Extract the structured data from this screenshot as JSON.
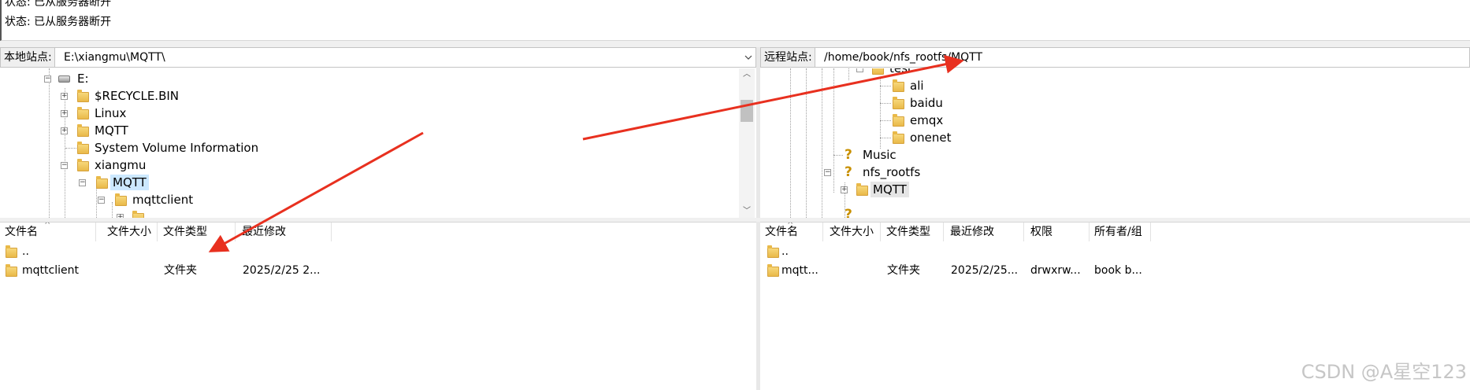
{
  "status_log": {
    "lines": [
      "状态:  已从服务器断开",
      "状态:  已从服务器断开"
    ]
  },
  "local": {
    "site_label": "本地站点:",
    "path": "E:\\xiangmu\\MQTT\\",
    "tree": {
      "drive": "E:",
      "items": [
        "$RECYCLE.BIN",
        "Linux",
        "MQTT",
        "System Volume Information",
        "xiangmu",
        "MQTT",
        "mqttclient"
      ]
    },
    "columns": [
      "文件名",
      "文件大小",
      "文件类型",
      "最近修改"
    ],
    "files": [
      {
        "name": "..",
        "size": "",
        "type": "",
        "modified": ""
      },
      {
        "name": "mqttclient",
        "size": "",
        "type": "文件夹",
        "modified": "2025/2/25 2..."
      }
    ]
  },
  "remote": {
    "site_label": "远程站点:",
    "path": "/home/book/nfs_rootfs/MQTT",
    "tree": {
      "items": [
        "test",
        "ali",
        "baidu",
        "emqx",
        "onenet",
        "Music",
        "nfs_rootfs",
        "MQTT"
      ]
    },
    "columns": [
      "文件名",
      "文件大小",
      "文件类型",
      "最近修改",
      "权限",
      "所有者/组"
    ],
    "files": [
      {
        "name": "..",
        "size": "",
        "type": "",
        "modified": "",
        "perms": "",
        "owner": ""
      },
      {
        "name": "mqtt...",
        "size": "",
        "type": "文件夹",
        "modified": "2025/2/25...",
        "perms": "drwxrw...",
        "owner": "book b..."
      }
    ]
  },
  "watermark": "CSDN @A星空123",
  "colors": {
    "annotation_arrow": "#e8301f",
    "selected_bg": "#cce8ff"
  }
}
